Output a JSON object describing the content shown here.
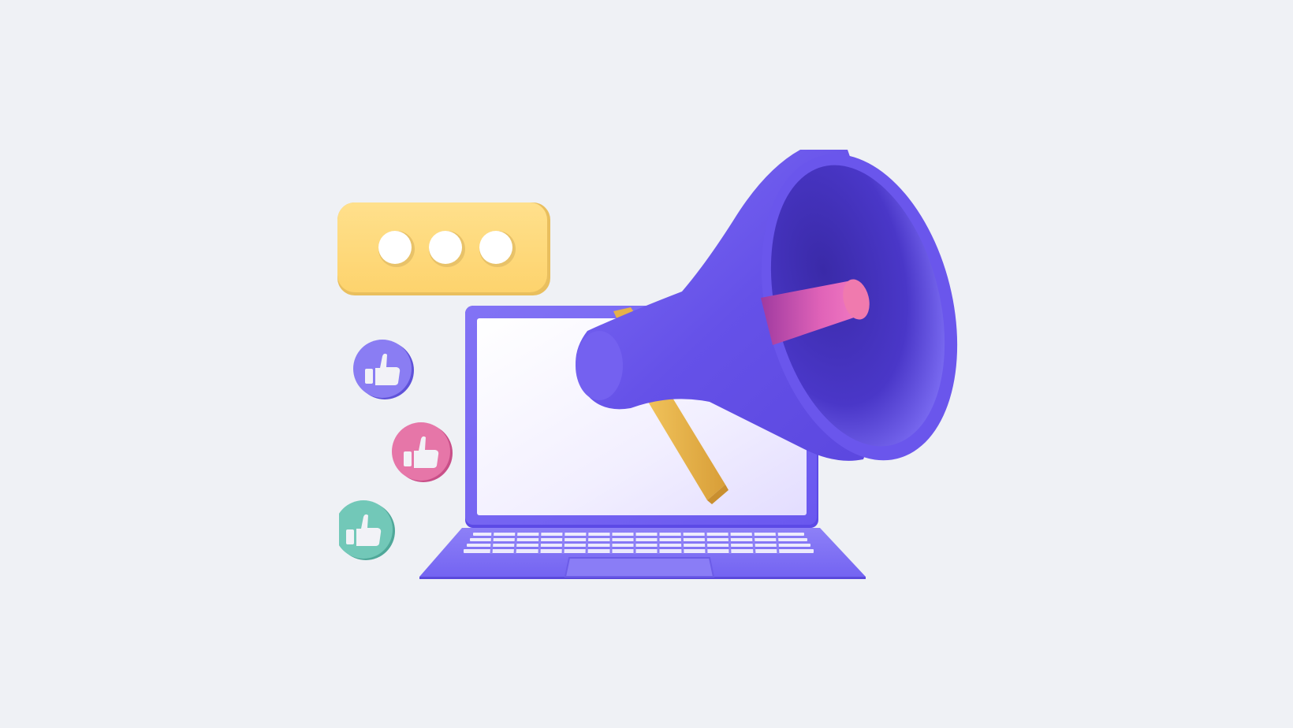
{
  "scene": {
    "kind": "marketing-illustration",
    "elements": [
      "typing-indicator-bubble",
      "thumbs-up-icon",
      "thumbs-up-icon",
      "thumbs-up-icon",
      "laptop",
      "megaphone-icon"
    ]
  },
  "colors": {
    "background": "#eff1f5",
    "bubble": "#ffd97a",
    "bubble_dots": "#ffffff",
    "laptop_body": "#7b6cf6",
    "laptop_screen": "#f6f4ff",
    "keyboard_keys": "#ffffff",
    "megaphone": "#6f5cf0",
    "megaphone_inner": "#3e2fb0",
    "megaphone_pink": "#f06ab0",
    "handle": "#e9b44c",
    "like_purple": "#8a7df3",
    "like_pink": "#e676a8",
    "like_teal": "#72c8b8",
    "like_thumb": "#f2f2f7"
  },
  "icons": {
    "typing_dots": 3,
    "likes": [
      "thumbs-up-icon",
      "thumbs-up-icon",
      "thumbs-up-icon"
    ],
    "main": "megaphone-icon",
    "device": "laptop-icon"
  }
}
